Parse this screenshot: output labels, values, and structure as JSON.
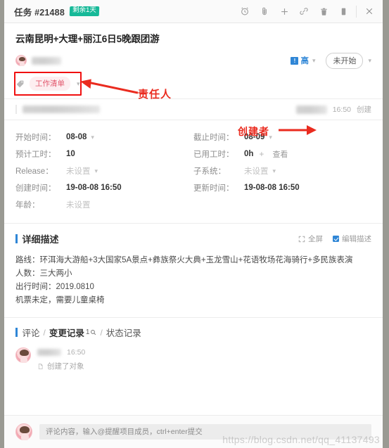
{
  "window": {
    "task_id": "任务 #21488",
    "remaining_badge": "剩余1天",
    "icons": [
      "alarm-clock-icon",
      "paperclip-icon",
      "plus-icon",
      "link-icon",
      "trash-icon",
      "copy-icon",
      "close-icon"
    ]
  },
  "task": {
    "title": "云南昆明+大理+丽江6日5晚跟团游",
    "assignee_name": "",
    "priority_flag": "!",
    "priority_label": "高",
    "status_label": "未开始",
    "tag_label": "工作清单"
  },
  "creator_row": {
    "creator_name": "",
    "time": "16:50",
    "action": "创建"
  },
  "annotations": {
    "assignee": "责任人",
    "creator": "创建者",
    "color": "#ea2b1f"
  },
  "fields": {
    "rows": [
      {
        "left": {
          "label": "开始时间：",
          "value": "08-08",
          "muted": false,
          "caret": true
        },
        "right": {
          "label": "截止时间：",
          "value": "08-09",
          "muted": false,
          "caret": true
        }
      },
      {
        "left": {
          "label": "预计工时：",
          "value": "10",
          "muted": false,
          "caret": false
        },
        "right": {
          "label": "已用工时：",
          "value": "0h",
          "muted": false,
          "caret": false,
          "plus": "+",
          "link": "查看"
        }
      },
      {
        "left": {
          "label": "Release：",
          "value": "未设置",
          "muted": true,
          "caret": true
        },
        "right": {
          "label": "子系统：",
          "value": "未设置",
          "muted": true,
          "caret": true
        }
      },
      {
        "left": {
          "label": "创建时间：",
          "value": "19-08-08 16:50",
          "muted": false,
          "caret": false
        },
        "right": {
          "label": "更新时间：",
          "value": "19-08-08 16:50",
          "muted": false,
          "caret": false
        }
      },
      {
        "left": {
          "label": "年龄：",
          "value": "未设置",
          "muted": true,
          "caret": false
        },
        "right": {
          "label": "",
          "value": "",
          "muted": false,
          "caret": false
        }
      }
    ]
  },
  "description": {
    "section_title": "详细描述",
    "fullscreen_label": "全屏",
    "edit_label": "编辑描述",
    "lines": [
      "路线：环洱海大游船+3大国家5A景点+彝族祭火大典+玉龙雪山+花语牧场花海骑行+多民族表演",
      "人数：三大两小",
      "出行时间：2019.0810",
      "机票未定，需要儿童桌椅"
    ]
  },
  "comments": {
    "tabs": [
      {
        "label": "评论",
        "active": false
      },
      {
        "label": "变更记录",
        "active": true,
        "count": "1"
      },
      {
        "label": "状态记录",
        "active": false
      }
    ],
    "separator": "/",
    "items": [
      {
        "name": "",
        "time": "16:50",
        "text": "创建了对象"
      }
    ]
  },
  "composer": {
    "placeholder": "评论内容，输入@提醒项目成员，ctrl+enter提交"
  },
  "watermark": "https://blog.csdn.net/qq_41137493"
}
